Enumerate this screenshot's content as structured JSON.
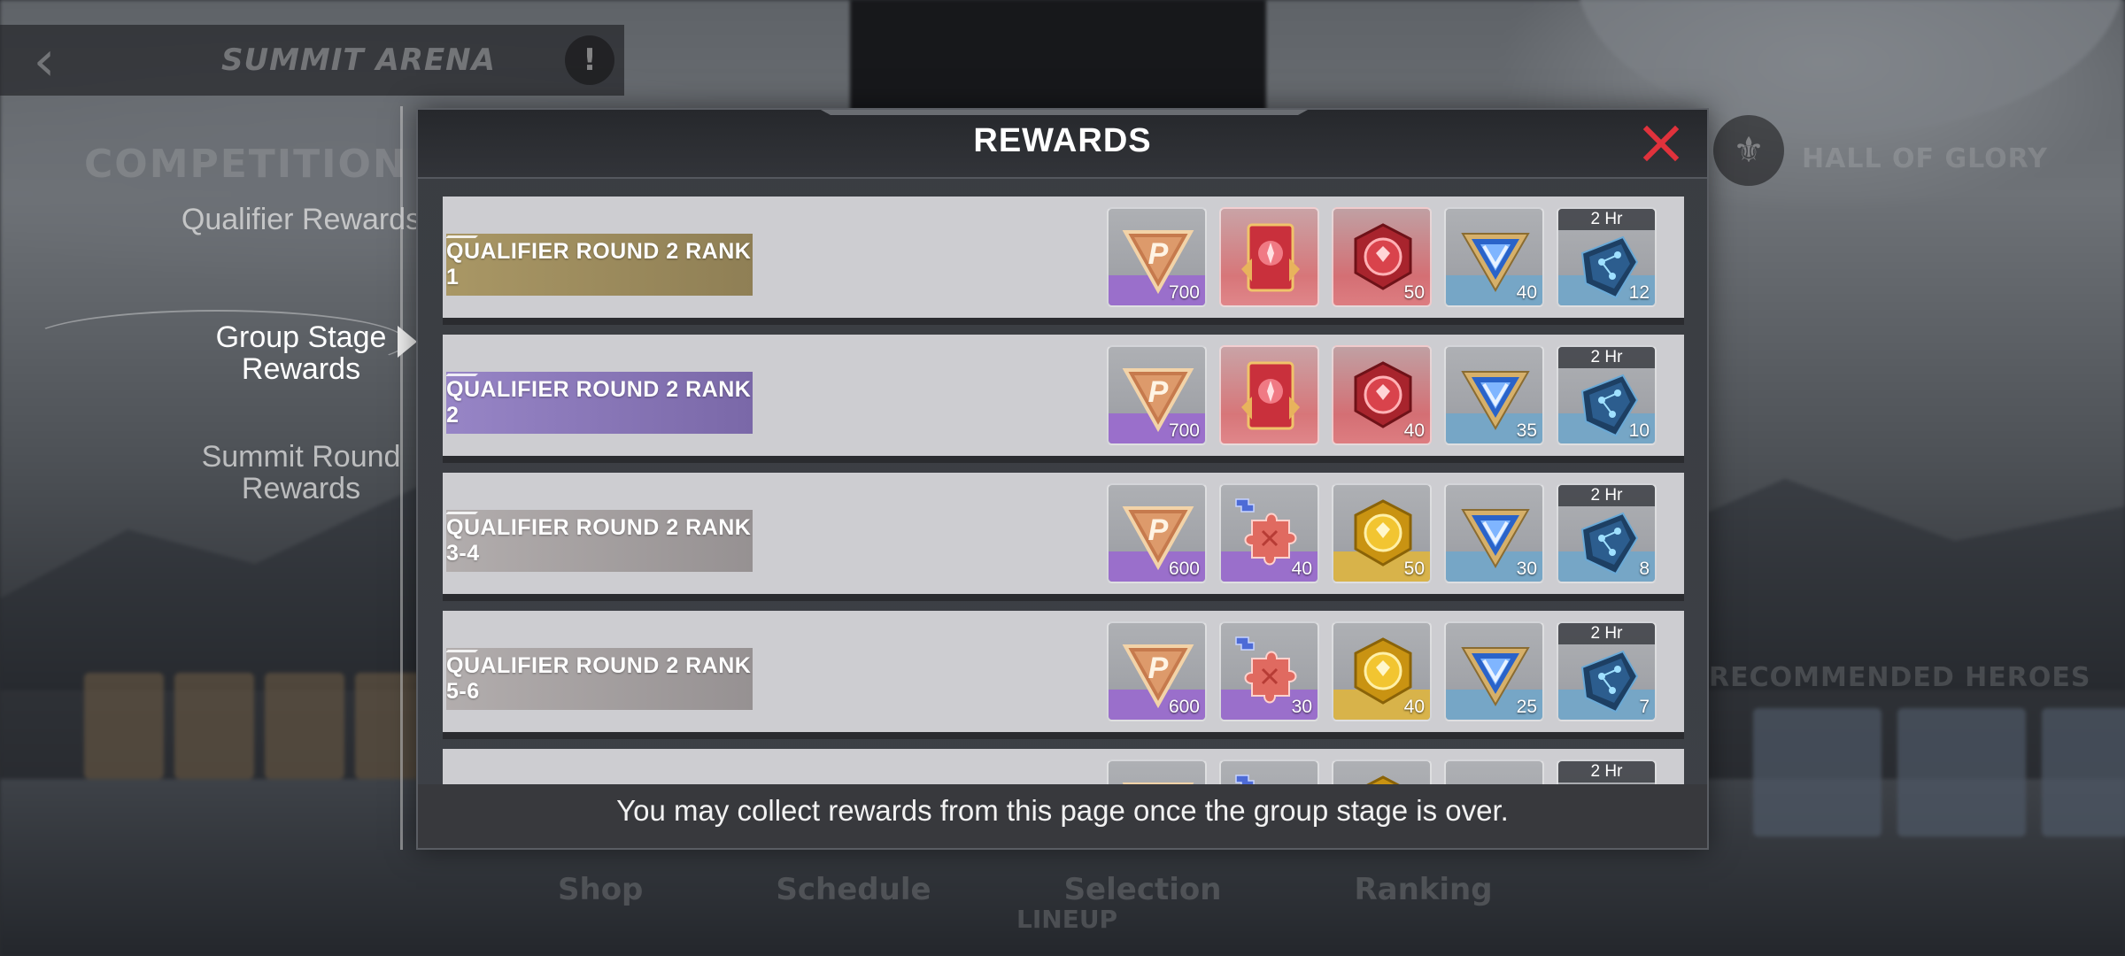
{
  "background": {
    "header_title": "SUMMIT ARENA",
    "competition_label": "COMPETITION",
    "hall_label": "HALL OF GLORY",
    "recommended_label": "RECOMMENDED HEROES",
    "nav": [
      "Shop",
      "Schedule",
      "Selection",
      "Ranking"
    ],
    "lineup_label": "LINEUP"
  },
  "side_tabs": [
    {
      "label": "Qualifier Rewards",
      "active": false
    },
    {
      "label": "Group Stage Rewards",
      "active": true
    },
    {
      "label": "Summit Round Rewards",
      "active": false
    }
  ],
  "modal": {
    "title": "REWARDS",
    "footer": "You may collect rewards from this page once the group stage is over."
  },
  "rows": [
    {
      "rank": "QUALIFIER ROUND 2 RANK 1",
      "tier": "gold",
      "items": [
        {
          "icon": "p-points-icon",
          "count": "700",
          "strip": "purple"
        },
        {
          "icon": "red-card-icon",
          "count": "",
          "strip": "red"
        },
        {
          "icon": "red-coin-icon",
          "count": "50",
          "strip": "red"
        },
        {
          "icon": "blue-v-emblem-icon",
          "count": "40",
          "strip": "blue"
        },
        {
          "icon": "blue-crystal-icon",
          "count": "12",
          "strip": "blue",
          "timer": "2 Hr"
        }
      ]
    },
    {
      "rank": "QUALIFIER ROUND 2 RANK 2",
      "tier": "purple",
      "items": [
        {
          "icon": "p-points-icon",
          "count": "700",
          "strip": "purple"
        },
        {
          "icon": "red-card-icon",
          "count": "",
          "strip": "red"
        },
        {
          "icon": "red-coin-icon",
          "count": "40",
          "strip": "red"
        },
        {
          "icon": "blue-v-emblem-icon",
          "count": "35",
          "strip": "blue"
        },
        {
          "icon": "blue-crystal-icon",
          "count": "10",
          "strip": "blue",
          "timer": "2 Hr"
        }
      ]
    },
    {
      "rank": "QUALIFIER ROUND 2 RANK 3-4",
      "tier": "grey",
      "items": [
        {
          "icon": "p-points-icon",
          "count": "600",
          "strip": "purple"
        },
        {
          "icon": "red-puzzle-icon",
          "count": "40",
          "strip": "purple"
        },
        {
          "icon": "gold-coin-icon",
          "count": "50",
          "strip": "gold"
        },
        {
          "icon": "blue-v-emblem-icon",
          "count": "30",
          "strip": "blue"
        },
        {
          "icon": "blue-crystal-icon",
          "count": "8",
          "strip": "blue",
          "timer": "2 Hr"
        }
      ]
    },
    {
      "rank": "QUALIFIER ROUND 2 RANK 5-6",
      "tier": "grey",
      "items": [
        {
          "icon": "p-points-icon",
          "count": "600",
          "strip": "purple"
        },
        {
          "icon": "red-puzzle-icon",
          "count": "30",
          "strip": "purple"
        },
        {
          "icon": "gold-coin-icon",
          "count": "40",
          "strip": "gold"
        },
        {
          "icon": "blue-v-emblem-icon",
          "count": "25",
          "strip": "blue"
        },
        {
          "icon": "blue-crystal-icon",
          "count": "7",
          "strip": "blue",
          "timer": "2 Hr"
        }
      ]
    },
    {
      "rank": "",
      "tier": "grey",
      "items": [
        {
          "icon": "p-points-icon",
          "count": "",
          "strip": "purple"
        },
        {
          "icon": "red-puzzle-icon",
          "count": "",
          "strip": "purple"
        },
        {
          "icon": "gold-coin-icon",
          "count": "",
          "strip": "gold"
        },
        {
          "icon": "blue-v-emblem-icon",
          "count": "",
          "strip": "blue"
        },
        {
          "icon": "blue-crystal-icon",
          "count": "",
          "strip": "blue",
          "timer": "2 Hr"
        }
      ]
    }
  ],
  "colors": {
    "accent_close": "#e0323c",
    "tier_gold": "#a99765",
    "tier_purple": "#9785c6",
    "tier_grey": "#b2adad"
  }
}
